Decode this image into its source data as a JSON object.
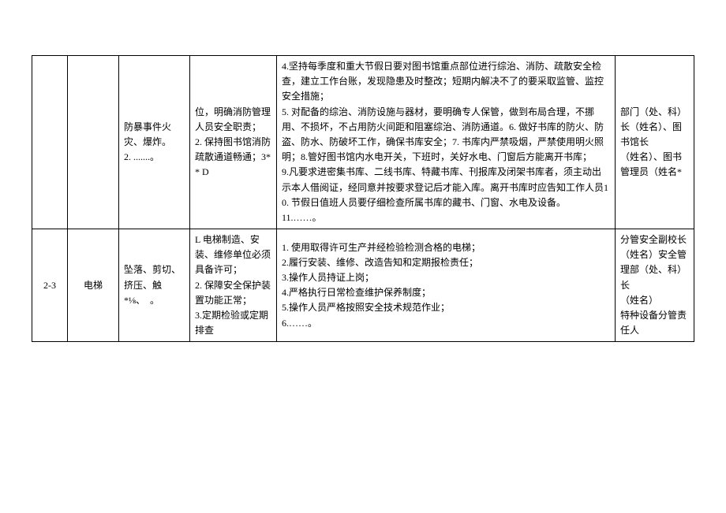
{
  "rows": [
    {
      "id": "",
      "item": "",
      "risk": "防暴事件火灾、爆炸。\n2. .......。",
      "mgmt": "位，明确消防管理人员安全职责；\n2. 保持图书馆消防疏散通道畅通；3** D",
      "meas": "4.坚持每季度和重大节假日要对图书馆重点部位进行综治、消防、疏散安全检查，建立工作台账，发现隐患及时整改；短期内解决不了的要采取监管、监控安全措施；\n5. 对配备的综治、消防设施与器材，要明确专人保管，做到布局合理，不挪用、不损坏，不占用防火间距和阻塞综治、消防通道。6. 做好书库的防火、防盗、防水、防破坏工作，确保书库安全；7. 书库内严禁吸烟，严禁使用明火照明；8.管好图书馆内水电开关，下班时，关好水电、门窗后方能离开书库；\n9.凡要求进密集书库、二线书库、特藏书库、刊报库及闭架书库者，须主动出示本人借阅证，经同意并按要求登记后才能入库。离开书库时应告知工作人员10. 节假日值班人员要仔细检查所属书库的藏书、门窗、水电及设备。\n11.……。",
      "resp": "部门（处、科）长（姓名）、图书馆长\n（姓名）、图书管理员（姓名*"
    },
    {
      "id": "2-3",
      "item": "电梯",
      "risk": "坠落、剪切、挤压、触\n*⅛、　。",
      "mgmt": "L 电梯制造、安装、维修单位必须具备许可；\n2. 保障安全保护装置功能正常；\n3.定期检验或定期排查",
      "meas": "1. 使用取得许可生产并经检验检测合格的电梯；\n2.履行安装、维修、改造告知和定期报检责任；\n3.操作人员持证上岗；\n4.严格执行日常检查维护保养制度；\n5.操作人员严格按照安全技术规范作业；\n6.……。",
      "resp": "分管安全副校长（姓名）安全管理部（处、科）长\n（姓名）\n特种设备分管责任人"
    }
  ]
}
